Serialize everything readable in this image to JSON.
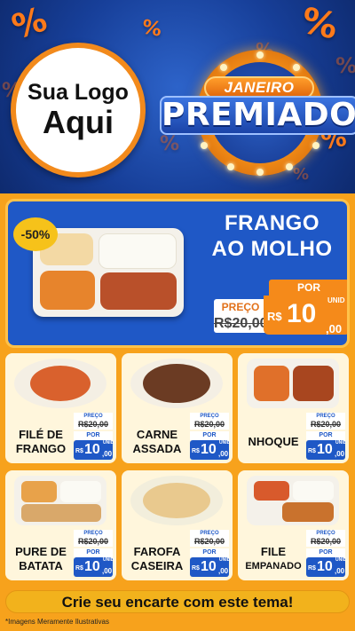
{
  "header": {
    "logo_line1": "Sua Logo",
    "logo_line2": "Aqui",
    "badge_top": "JANEIRO",
    "badge_main": "PREMIADO",
    "percent_glyph": "%"
  },
  "featured": {
    "discount": "-50%",
    "title_line1": "FRANGO",
    "title_line2": "AO MOLHO",
    "preco_label": "PREÇO",
    "old_price": "R$20,00",
    "por_label": "POR",
    "currency": "R$",
    "price_int": "10",
    "price_dec": ",00",
    "unit": "UNID"
  },
  "products": [
    {
      "line1": "FILÉ DE",
      "line2": "FRANGO",
      "preco_label": "PREÇO",
      "old_price": "R$20,00",
      "por_label": "POR",
      "currency": "R$",
      "price_int": "10",
      "price_dec": ",00",
      "unit": "UNID"
    },
    {
      "line1": "CARNE",
      "line2": "ASSADA",
      "preco_label": "PREÇO",
      "old_price": "R$20,00",
      "por_label": "POR",
      "currency": "R$",
      "price_int": "10",
      "price_dec": ",00",
      "unit": "UNID"
    },
    {
      "line1": "NHOQUE",
      "line2": "",
      "preco_label": "PREÇO",
      "old_price": "R$20,00",
      "por_label": "POR",
      "currency": "R$",
      "price_int": "10",
      "price_dec": ",00",
      "unit": "UNID"
    },
    {
      "line1": "PURE DE",
      "line2": "BATATA",
      "preco_label": "PREÇO",
      "old_price": "R$20,00",
      "por_label": "POR",
      "currency": "R$",
      "price_int": "10",
      "price_dec": ",00",
      "unit": "UNID"
    },
    {
      "line1": "FAROFA",
      "line2": "CASEIRA",
      "preco_label": "PREÇO",
      "old_price": "R$20,00",
      "por_label": "POR",
      "currency": "R$",
      "price_int": "10",
      "price_dec": ",00",
      "unit": "UNID"
    },
    {
      "line1": "FILE",
      "line2": "EMPANADO",
      "preco_label": "PREÇO",
      "old_price": "R$20,00",
      "por_label": "POR",
      "currency": "R$",
      "price_int": "10",
      "price_dec": ",00",
      "unit": "UNID"
    }
  ],
  "cta": "Crie seu encarte com este tema!",
  "footnote": "*Imagens Meramente Ilustrativas",
  "colors": {
    "header_blue": "#173f99",
    "orange_bg": "#f7a21c",
    "featured_blue": "#1f58c6",
    "price_orange": "#f58a1a",
    "card_cream": "#fff6dc"
  }
}
